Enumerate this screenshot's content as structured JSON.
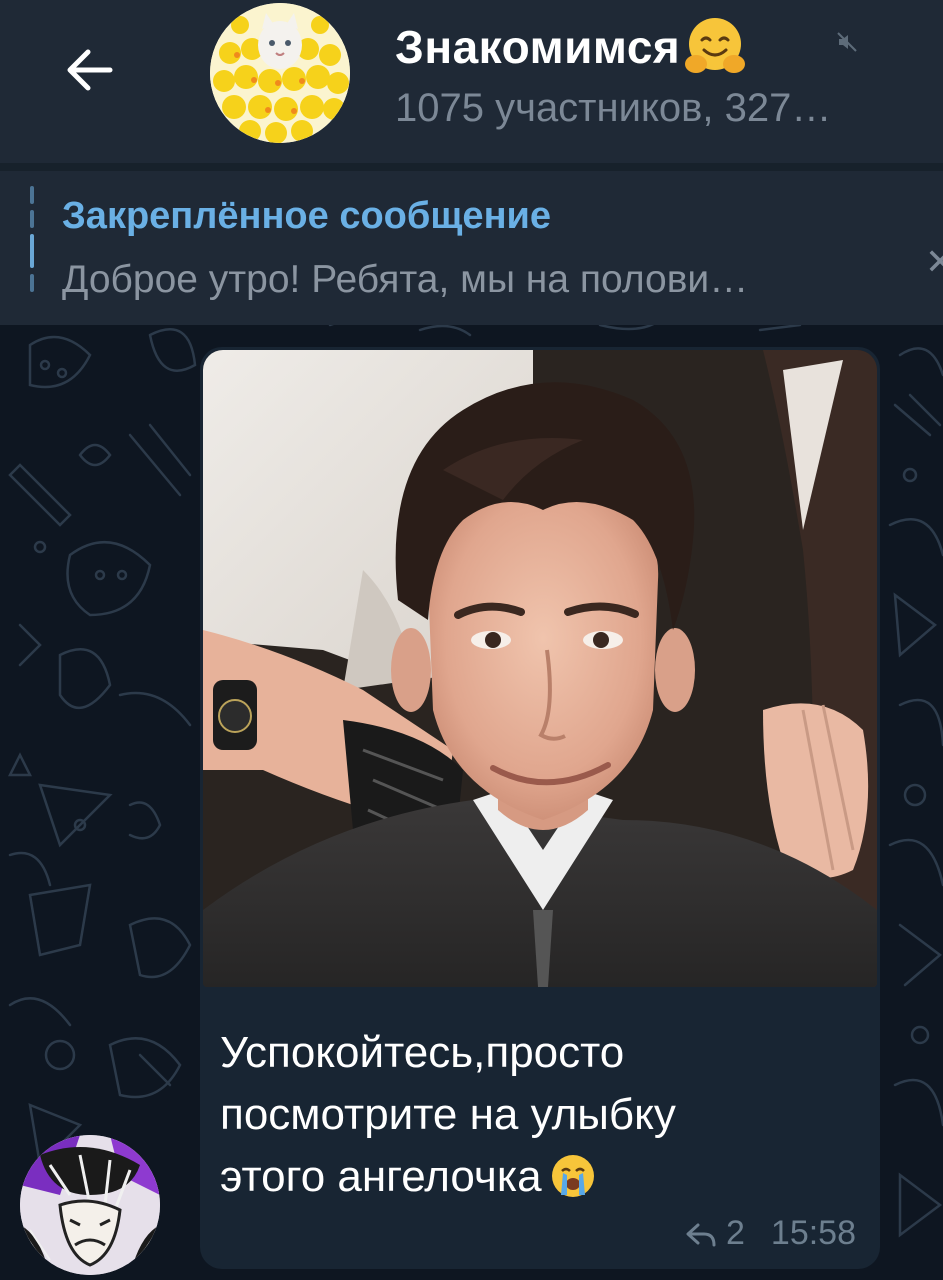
{
  "header": {
    "back_icon": "back-arrow-icon",
    "chat_title": "Знакомимся",
    "title_emoji": "hugging-face-emoji",
    "mute_icon": "muted-speaker-icon",
    "subtitle": "1075 участников, 327…"
  },
  "pinned": {
    "title": "Закреплённое сообщение",
    "text": "Доброе утро!  Ребята, мы на полови…",
    "close_icon": "close-icon"
  },
  "message": {
    "photo_alt": "Фото",
    "text": "Успокойтесь,просто посмотрите на улыбку этого ангелочка",
    "text_emoji": "loudly-crying-face-emoji",
    "reply_icon": "reply-arrow-icon",
    "reply_count": "2",
    "time": "15:58"
  },
  "colors": {
    "header_bg": "#1f2936",
    "chat_bg": "#0e1621",
    "bubble_bg": "#182533",
    "accent": "#6ab0e5",
    "muted_text": "#7c8896"
  }
}
